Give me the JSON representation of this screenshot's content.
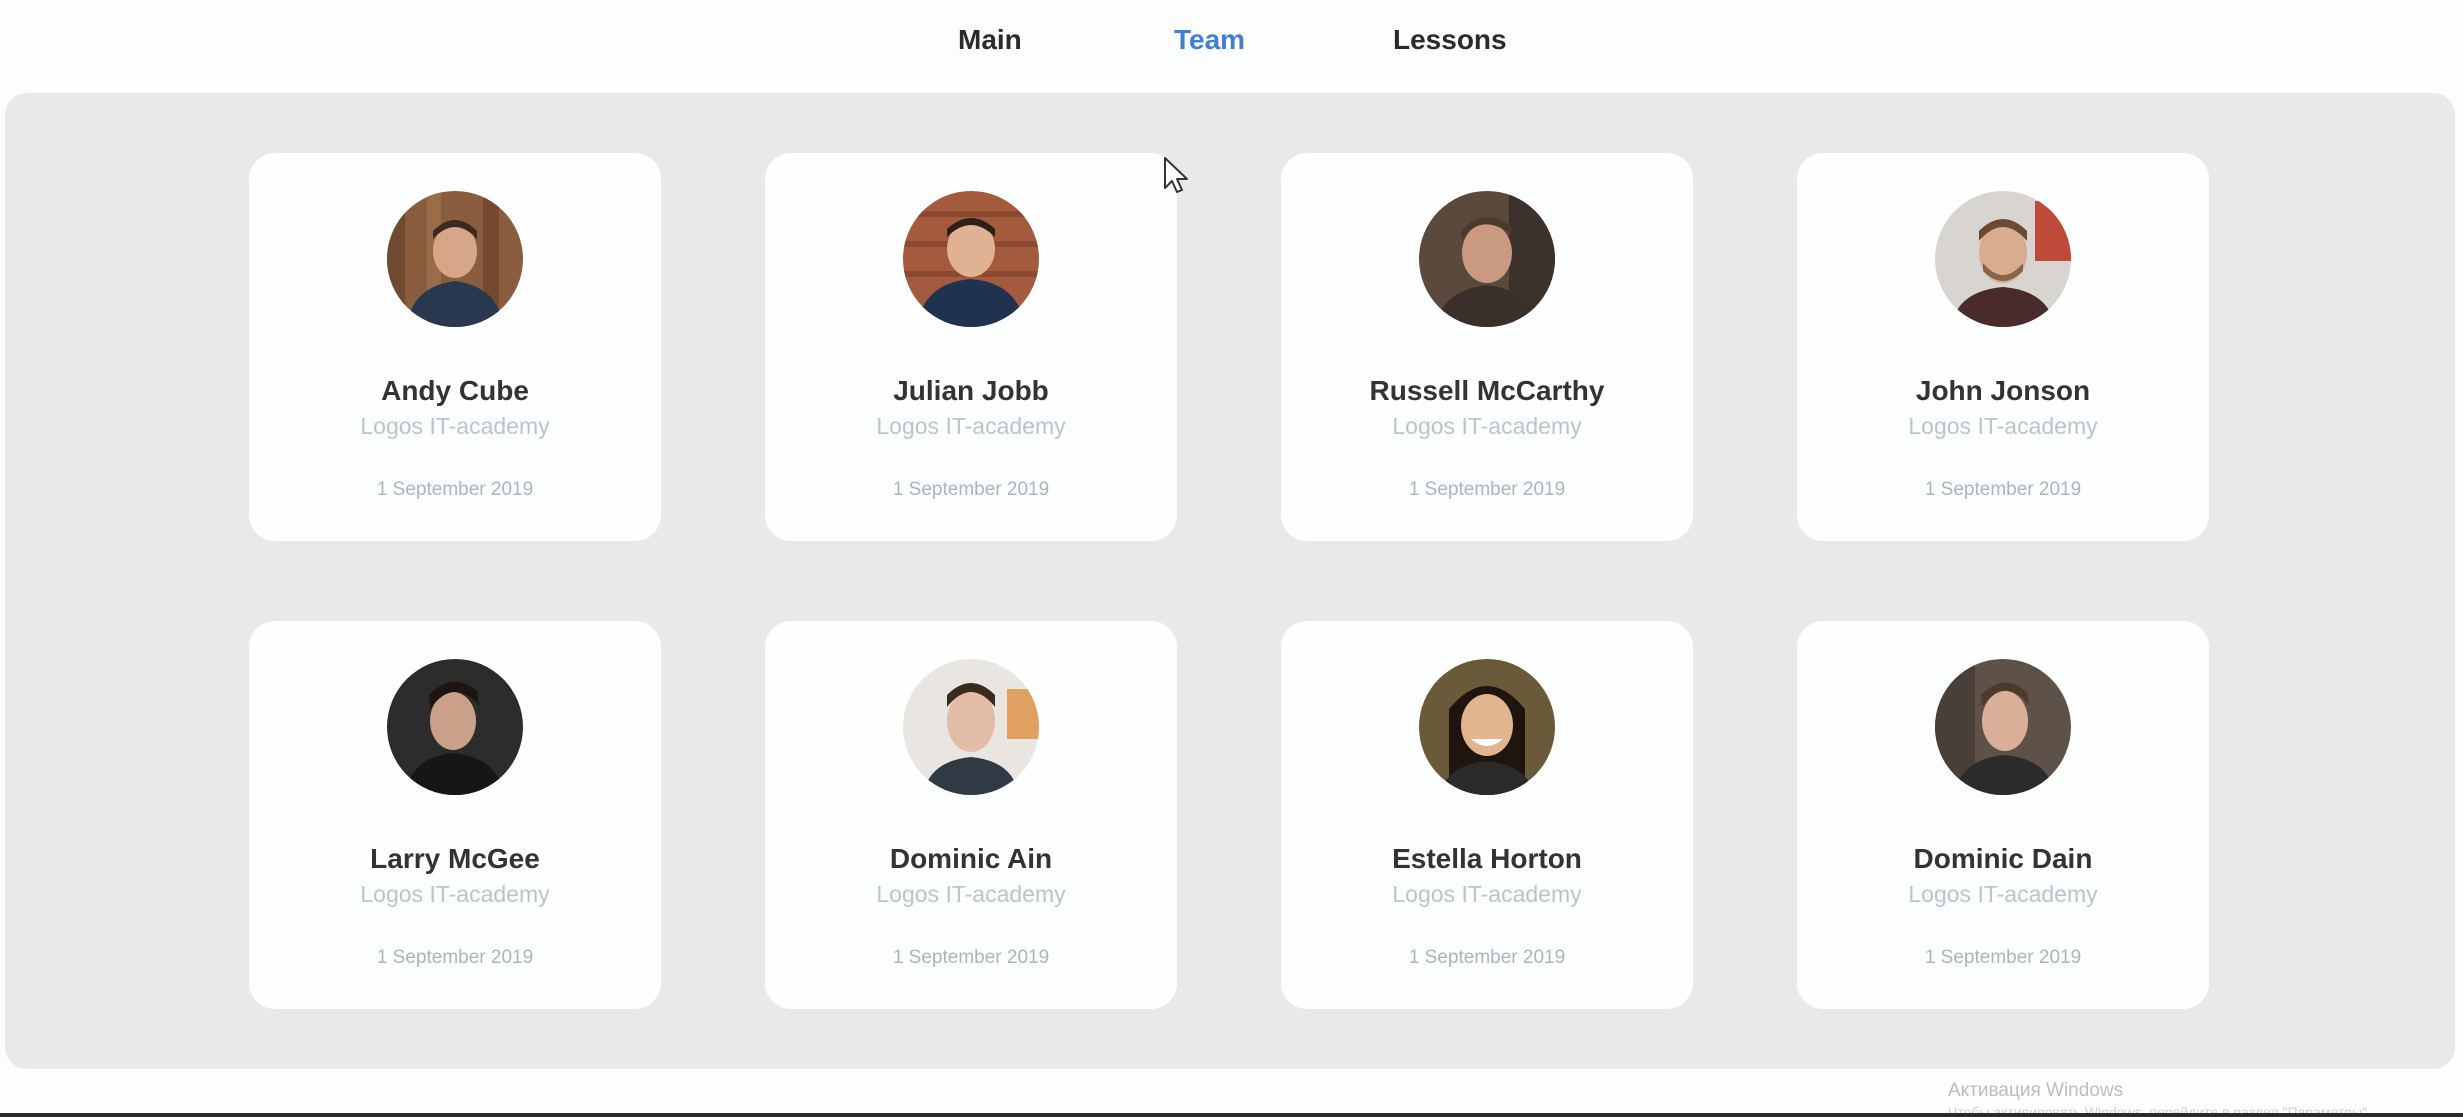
{
  "nav": {
    "items": [
      {
        "label": "Main"
      },
      {
        "label": "Team"
      },
      {
        "label": "Lessons"
      }
    ],
    "active": "Team",
    "accent_color": "#3f7fd6"
  },
  "team": {
    "members": [
      {
        "name": "Andy Cube",
        "org": "Logos IT-academy",
        "date": "1 September 2019"
      },
      {
        "name": "Julian Jobb",
        "org": "Logos IT-academy",
        "date": "1 September 2019"
      },
      {
        "name": "Russell McCarthy",
        "org": "Logos IT-academy",
        "date": "1 September 2019"
      },
      {
        "name": "John Jonson",
        "org": "Logos IT-academy",
        "date": "1 September 2019"
      },
      {
        "name": "Larry McGee",
        "org": "Logos IT-academy",
        "date": "1 September 2019"
      },
      {
        "name": "Dominic Ain",
        "org": "Logos IT-academy",
        "date": "1 September 2019"
      },
      {
        "name": "Estella Horton",
        "org": "Logos IT-academy",
        "date": "1 September 2019"
      },
      {
        "name": "Dominic Dain",
        "org": "Logos IT-academy",
        "date": "1 September 2019"
      }
    ]
  },
  "watermark": {
    "title": "Активация Windows",
    "subtitle": "Чтобы активировать Windows, перейдите в раздел \"Параметры\"."
  }
}
